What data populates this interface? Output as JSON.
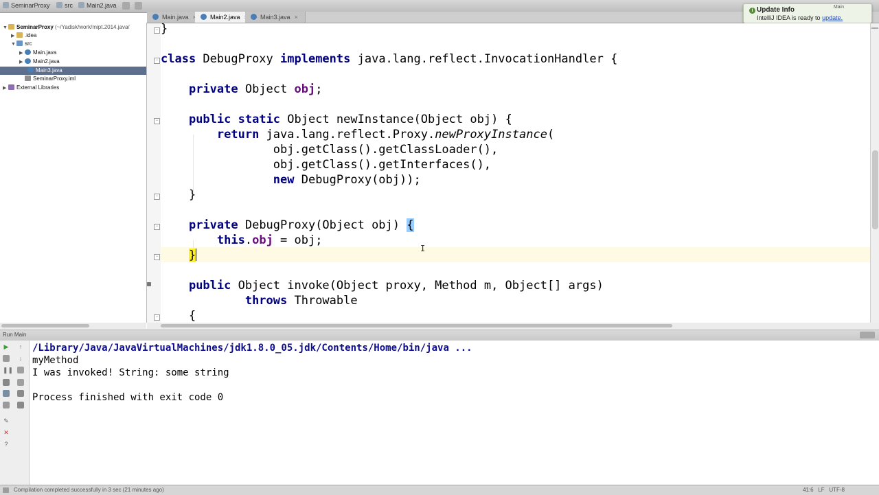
{
  "breadcrumb": {
    "project": "SeminarProxy",
    "folder": "src",
    "file": "Main2.java"
  },
  "tabs": [
    {
      "label": "Main.java",
      "active": false
    },
    {
      "label": "Main2.java",
      "active": true
    },
    {
      "label": "Main3.java",
      "active": false
    }
  ],
  "update_popup": {
    "title": "Update Info",
    "text": "IntelliJ IDEA is ready to",
    "link": "update.",
    "run_label": "Main"
  },
  "project_tree": {
    "root_label": "SeminarProxy",
    "root_path": "(~/Yadisk/work/mipt.2014.java/",
    "idea": ".idea",
    "src": "src",
    "main": "Main.java",
    "main2": "Main2.java",
    "main3": "Main3.java",
    "iml": "SeminarProxy.iml",
    "ext_libs": "External Libraries"
  },
  "code": {
    "l0_brace": "}",
    "l1_kw1": "class",
    "l1_a": " DebugProxy ",
    "l1_kw2": "implements",
    "l1_b": " java.lang.reflect.InvocationHandler {",
    "l2_indent": "    ",
    "l2_kw": "private",
    "l2_a": " Object ",
    "l2_fld": "obj",
    "l2_b": ";",
    "l3_indent": "    ",
    "l3_kw1": "public",
    "l3_sp": " ",
    "l3_kw2": "static",
    "l3_a": " Object newInstance(Object obj) {",
    "l4_indent": "        ",
    "l4_kw": "return",
    "l4_a": " java.lang.reflect.Proxy.",
    "l4_it": "newProxyInstance",
    "l4_b": "(",
    "l5": "                obj.getClass().getClassLoader(),",
    "l6": "                obj.getClass().getInterfaces(),",
    "l7_indent": "                ",
    "l7_kw": "new",
    "l7_a": " DebugProxy(obj));",
    "l8": "    }",
    "l9_indent": "    ",
    "l9_kw": "private",
    "l9_a": " DebugProxy(Object obj) ",
    "l9_brace": "{",
    "l10_indent": "        ",
    "l10_kw": "this",
    "l10_a": ".",
    "l10_fld": "obj",
    "l10_b": " = obj;",
    "l11_indent": "    ",
    "l11_brace": "}",
    "l12_indent": "    ",
    "l12_kw": "public",
    "l12_a": " Object invoke(Object proxy, Method m, Object[] args)",
    "l13_indent": "            ",
    "l13_kw": "throws",
    "l13_a": " Throwable",
    "l14": "    {"
  },
  "run_panel": {
    "label": "Run",
    "config": "Main",
    "lines": {
      "cmd": "/Library/Java/JavaVirtualMachines/jdk1.8.0_05.jdk/Contents/Home/bin/java ...",
      "out1": "myMethod",
      "out2": "I was invoked! String: some string",
      "exit": "Process finished with exit code 0"
    }
  },
  "statusbar": {
    "message": "Compilation completed successfully in 3 sec (21 minutes ago)",
    "position": "41:6",
    "line_sep": "LF",
    "encoding": "UTF-8"
  },
  "colors": {
    "keyword": "#000080",
    "field": "#660e7a",
    "caret_line": "#fffae3",
    "brace_match": "#99ccff",
    "selection": "#5d6f8c"
  }
}
